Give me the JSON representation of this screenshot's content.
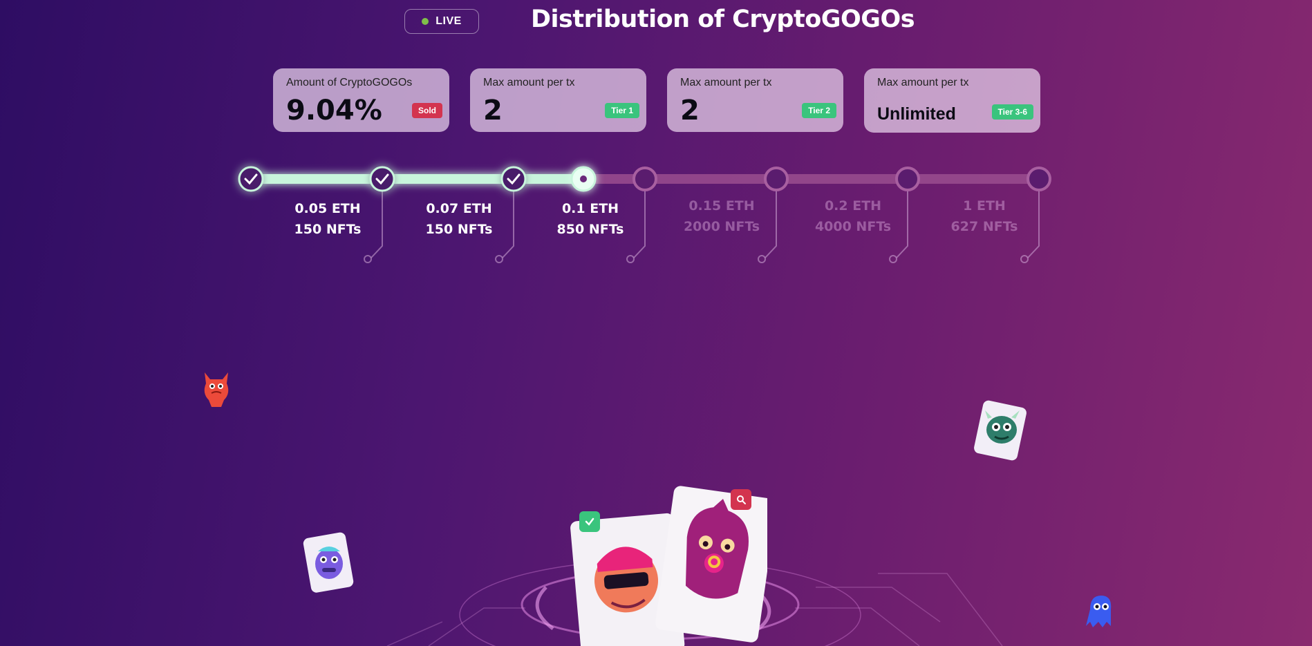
{
  "header": {
    "live_label": "LIVE",
    "title": "Distribution of CryptoGOGOs"
  },
  "colors": {
    "accent_green": "#3ac47d",
    "sold_red": "#d3344f",
    "track_active": "#c8f5dc",
    "track_inactive": "#9a4d8f"
  },
  "cards": [
    {
      "label": "Amount of CryptoGOGOs",
      "value": "9.04%",
      "badge": "Sold"
    },
    {
      "label": "Max amount per tx",
      "value": "2",
      "badge": "Tier 1"
    },
    {
      "label": "Max amount per tx",
      "value": "2",
      "badge": "Tier 2"
    },
    {
      "label": "Max amount per tx",
      "value": "Unlimited",
      "badge": "Tier 3-6"
    }
  ],
  "tiers": [
    {
      "price": "0.05 ETH",
      "amount": "150 NFTs",
      "status": "completed"
    },
    {
      "price": "0.07 ETH",
      "amount": "150 NFTs",
      "status": "completed"
    },
    {
      "price": "0.1 ETH",
      "amount": "850 NFTs",
      "status": "current"
    },
    {
      "price": "0.15 ETH",
      "amount": "2000 NFTs",
      "status": "upcoming"
    },
    {
      "price": "0.2 ETH",
      "amount": "4000 NFTs",
      "status": "upcoming"
    },
    {
      "price": "1 ETH",
      "amount": "627 NFTs",
      "status": "upcoming"
    }
  ],
  "icons": {
    "verified": "check-icon",
    "inspect": "magnifier-icon"
  }
}
